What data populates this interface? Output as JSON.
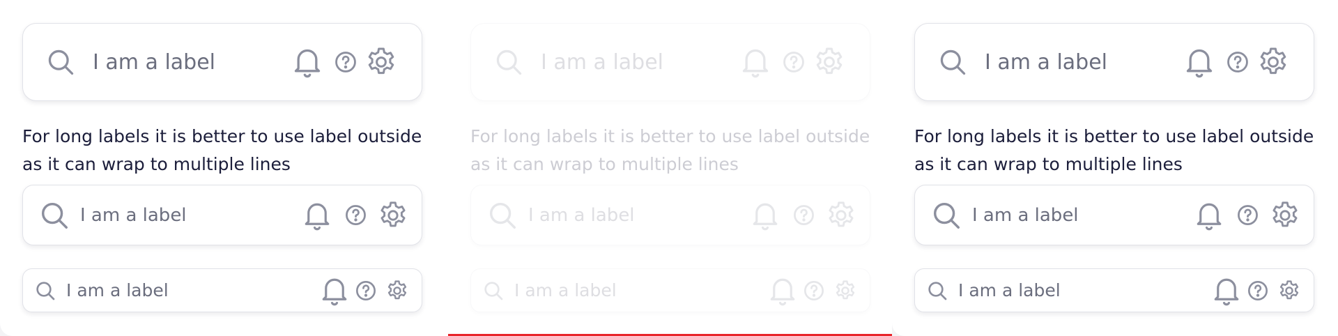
{
  "field_label": "I am a label",
  "helper_text": "For long labels it is better to use label outside as it can wrap to multiple lines",
  "icons": {
    "leading": "search-icon",
    "trailing": [
      "bell-icon",
      "help-circle-icon",
      "gear-icon"
    ]
  },
  "colors": {
    "icon": "#8c8f9e",
    "label": "#6b6e7e",
    "helper_text": "#1b1d3a",
    "border": "#e1e2e8",
    "accent_bar": "#e8242a"
  },
  "variants": [
    {
      "id": "default",
      "state": "enabled"
    },
    {
      "id": "disabled",
      "state": "disabled"
    },
    {
      "id": "default-copy",
      "state": "enabled"
    }
  ],
  "sizes": [
    "large",
    "medium",
    "small"
  ]
}
